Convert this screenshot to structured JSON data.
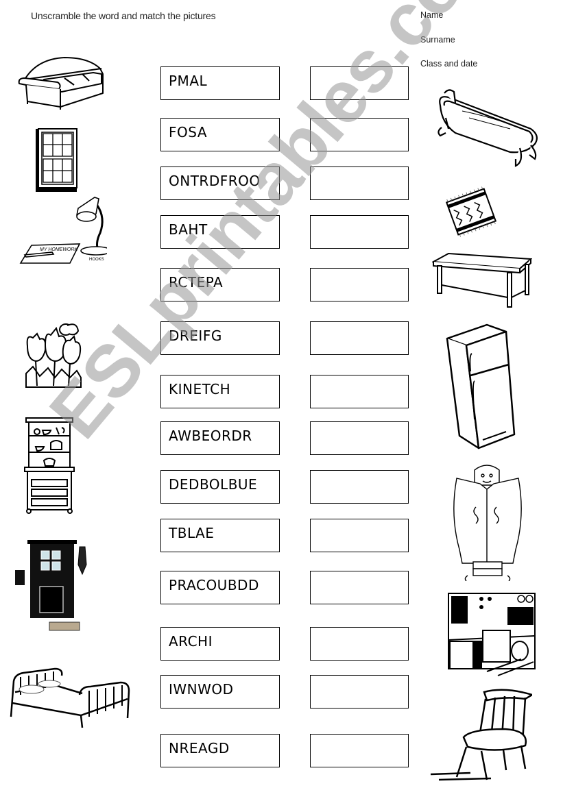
{
  "header": {
    "instruction": "Unscramble the word and match the pictures",
    "fields": [
      "Name",
      "Surname",
      "Class and date"
    ]
  },
  "scrambled_words": [
    "PMAL",
    "FOSA",
    "ONTRDFROO",
    "BAHT",
    "RCTEPA",
    "DREIFG",
    "KINETCH",
    "AWBEORDR",
    "DEDBOLBUE",
    "TBLAE",
    "PRACOUBDD",
    "ARCHI",
    "IWNWOD",
    "NREAGD"
  ],
  "answers": [
    "",
    "",
    "",
    "",
    "",
    "",
    "",
    "",
    "",
    "",
    "",
    "",
    "",
    ""
  ],
  "left_pictures": [
    "sofa",
    "window",
    "desk-lamp",
    "garden-flowers",
    "cupboard",
    "front-door",
    "bed"
  ],
  "right_pictures": [
    "bathtub",
    "carpet",
    "table",
    "fridge",
    "wardrobe",
    "kitchen",
    "chair"
  ],
  "watermark": "ESLprintables.com"
}
